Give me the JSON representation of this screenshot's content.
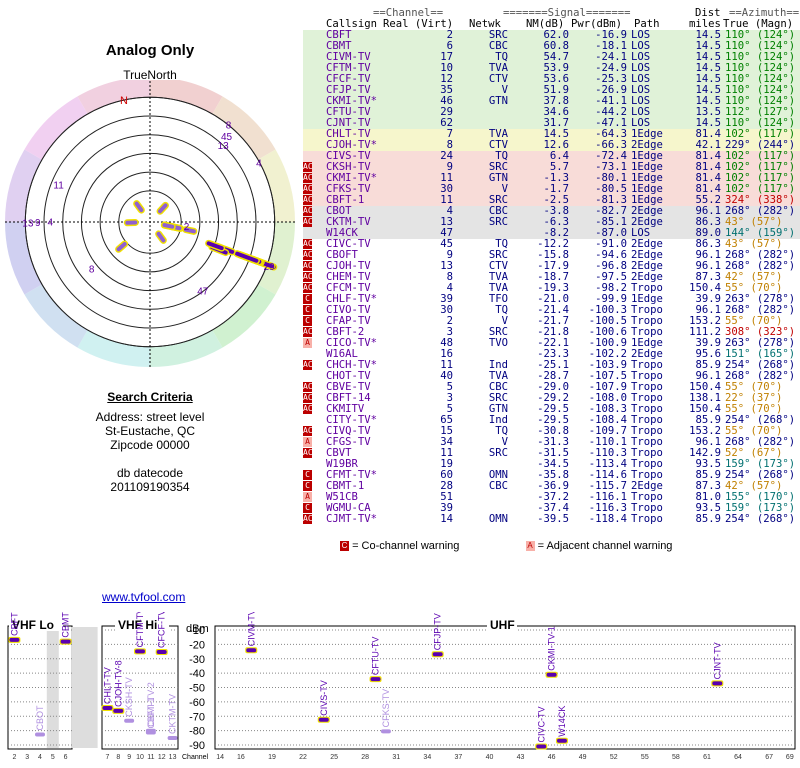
{
  "title": "Analog Only",
  "true_north": "TrueNorth",
  "compass_n": "N",
  "search": {
    "heading": "Search Criteria",
    "address": "Address: street level",
    "city": "St-Eustache, QC",
    "zip": "Zipcode 00000",
    "db_label": "db datecode",
    "db_value": "201109190354"
  },
  "link": "www.tvfool.com",
  "table_headers": {
    "channel_group": "==Channel==",
    "signal_group": "=======Signal=======",
    "dist_group": "Dist",
    "azimuth_group": "==Azimuth==",
    "callsign": "Callsign",
    "real_virt": "Real (Virt)",
    "netwk": "Netwk",
    "nm": "NM(dB)",
    "pwr": "Pwr(dBm)",
    "path": "Path",
    "miles": "miles",
    "az": "True (Magn)"
  },
  "colors": {
    "green": "#e0f2d8",
    "yellow": "#f6f6cc",
    "red": "#f8dcd8",
    "grey": "#e4e4e4",
    "white": "#ffffff",
    "purple": "#7000b0",
    "green_az": "#008000",
    "red_az": "#c00000",
    "orange_az": "#c08000",
    "blue_az": "#000080",
    "teal_az": "#007070"
  },
  "stations": [
    {
      "call": "CBFT",
      "real": "2",
      "virt": "",
      "net": "SRC",
      "nm": "62.0",
      "pwr": "-16.9",
      "path": "LOS",
      "dist": "14.5",
      "az": "110° (124°)",
      "bg": "green",
      "warn": "",
      "azc": "green_az"
    },
    {
      "call": "CBMT",
      "real": "6",
      "virt": "",
      "net": "CBC",
      "nm": "60.8",
      "pwr": "-18.1",
      "path": "LOS",
      "dist": "14.5",
      "az": "110° (124°)",
      "bg": "green",
      "warn": "",
      "azc": "green_az"
    },
    {
      "call": "CIVM-TV",
      "real": "17",
      "virt": "",
      "net": "TQ",
      "nm": "54.7",
      "pwr": "-24.1",
      "path": "LOS",
      "dist": "14.5",
      "az": "110° (124°)",
      "bg": "green",
      "warn": "",
      "azc": "green_az"
    },
    {
      "call": "CFTM-TV",
      "real": "10",
      "virt": "",
      "net": "TVA",
      "nm": "53.9",
      "pwr": "-24.9",
      "path": "LOS",
      "dist": "14.5",
      "az": "110° (124°)",
      "bg": "green",
      "warn": "",
      "azc": "green_az"
    },
    {
      "call": "CFCF-TV",
      "real": "12",
      "virt": "",
      "net": "CTV",
      "nm": "53.6",
      "pwr": "-25.3",
      "path": "LOS",
      "dist": "14.5",
      "az": "110° (124°)",
      "bg": "green",
      "warn": "",
      "azc": "green_az"
    },
    {
      "call": "CFJP-TV",
      "real": "35",
      "virt": "",
      "net": "V",
      "nm": "51.9",
      "pwr": "-26.9",
      "path": "LOS",
      "dist": "14.5",
      "az": "110° (124°)",
      "bg": "green",
      "warn": "",
      "azc": "green_az"
    },
    {
      "call": "CKMI-TV*",
      "real": "46",
      "virt": "",
      "net": "GTN",
      "nm": "37.8",
      "pwr": "-41.1",
      "path": "LOS",
      "dist": "14.5",
      "az": "110° (124°)",
      "bg": "green",
      "warn": "",
      "azc": "green_az"
    },
    {
      "call": "CFTU-TV",
      "real": "29",
      "virt": "",
      "net": "",
      "nm": "34.6",
      "pwr": "-44.2",
      "path": "LOS",
      "dist": "13.5",
      "az": "112° (127°)",
      "bg": "green",
      "warn": "",
      "azc": "green_az"
    },
    {
      "call": "CJNT-TV",
      "real": "62",
      "virt": "",
      "net": "",
      "nm": "31.7",
      "pwr": "-47.1",
      "path": "LOS",
      "dist": "14.5",
      "az": "110° (124°)",
      "bg": "green",
      "warn": "",
      "azc": "green_az"
    },
    {
      "call": "CHLT-TV",
      "real": "7",
      "virt": "",
      "net": "TVA",
      "nm": "14.5",
      "pwr": "-64.3",
      "path": "1Edge",
      "dist": "81.4",
      "az": "102° (117°)",
      "bg": "yellow",
      "warn": "",
      "azc": "green_az"
    },
    {
      "call": "CJOH-TV*",
      "real": "8",
      "virt": "",
      "net": "CTV",
      "nm": "12.6",
      "pwr": "-66.3",
      "path": "2Edge",
      "dist": "42.1",
      "az": "229° (244°)",
      "bg": "yellow",
      "warn": "",
      "azc": "blue_az"
    },
    {
      "call": "CIVS-TV",
      "real": "24",
      "virt": "",
      "net": "TQ",
      "nm": "6.4",
      "pwr": "-72.4",
      "path": "1Edge",
      "dist": "81.4",
      "az": "102° (117°)",
      "bg": "red",
      "warn": "",
      "azc": "green_az"
    },
    {
      "call": "CKSH-TV",
      "real": "9",
      "virt": "",
      "net": "SRC",
      "nm": "5.7",
      "pwr": "-73.1",
      "path": "1Edge",
      "dist": "81.4",
      "az": "102° (117°)",
      "bg": "red",
      "warn": "AC",
      "azc": "green_az"
    },
    {
      "call": "CKMI-TV*",
      "real": "11",
      "virt": "",
      "net": "GTN",
      "nm": "-1.3",
      "pwr": "-80.1",
      "path": "1Edge",
      "dist": "81.4",
      "az": "102° (117°)",
      "bg": "red",
      "warn": "AC",
      "azc": "green_az"
    },
    {
      "call": "CFKS-TV",
      "real": "30",
      "virt": "",
      "net": "V",
      "nm": "-1.7",
      "pwr": "-80.5",
      "path": "1Edge",
      "dist": "81.4",
      "az": "102° (117°)",
      "bg": "red",
      "warn": "AC",
      "azc": "green_az"
    },
    {
      "call": "CBFT-1",
      "real": "11",
      "virt": "",
      "net": "SRC",
      "nm": "-2.5",
      "pwr": "-81.3",
      "path": "1Edge",
      "dist": "55.2",
      "az": "324° (338°)",
      "bg": "red",
      "warn": "AC",
      "azc": "red_az"
    },
    {
      "call": "CBOT",
      "real": "4",
      "virt": "",
      "net": "CBC",
      "nm": "-3.8",
      "pwr": "-82.7",
      "path": "2Edge",
      "dist": "96.1",
      "az": "268° (282°)",
      "bg": "grey",
      "warn": "AC",
      "azc": "blue_az"
    },
    {
      "call": "CKTM-TV",
      "real": "13",
      "virt": "",
      "net": "SRC",
      "nm": "-6.3",
      "pwr": "-85.1",
      "path": "2Edge",
      "dist": "86.3",
      "az": "43° (57°)",
      "bg": "grey",
      "warn": "AC",
      "azc": "orange_az"
    },
    {
      "call": "W14CK",
      "real": "47",
      "virt": "",
      "net": "",
      "nm": "-8.2",
      "pwr": "-87.0",
      "path": "LOS",
      "dist": "89.0",
      "az": "144° (159°)",
      "bg": "grey",
      "warn": "",
      "azc": "teal_az"
    },
    {
      "call": "CIVC-TV",
      "real": "45",
      "virt": "",
      "net": "TQ",
      "nm": "-12.2",
      "pwr": "-91.0",
      "path": "2Edge",
      "dist": "86.3",
      "az": "43° (57°)",
      "bg": "white",
      "warn": "AC",
      "azc": "orange_az"
    },
    {
      "call": "CBOFT",
      "real": "9",
      "virt": "",
      "net": "SRC",
      "nm": "-15.8",
      "pwr": "-94.6",
      "path": "2Edge",
      "dist": "96.1",
      "az": "268° (282°)",
      "bg": "white",
      "warn": "AC",
      "azc": "blue_az"
    },
    {
      "call": "CJOH-TV",
      "real": "13",
      "virt": "",
      "net": "CTV",
      "nm": "-17.9",
      "pwr": "-96.8",
      "path": "2Edge",
      "dist": "96.1",
      "az": "268° (282°)",
      "bg": "white",
      "warn": "AC",
      "azc": "blue_az"
    },
    {
      "call": "CHEM-TV",
      "real": "8",
      "virt": "",
      "net": "TVA",
      "nm": "-18.7",
      "pwr": "-97.5",
      "path": "2Edge",
      "dist": "87.3",
      "az": "42° (57°)",
      "bg": "white",
      "warn": "AC",
      "azc": "orange_az"
    },
    {
      "call": "CFCM-TV",
      "real": "4",
      "virt": "",
      "net": "TVA",
      "nm": "-19.3",
      "pwr": "-98.2",
      "path": "Tropo",
      "dist": "150.4",
      "az": "55° (70°)",
      "bg": "white",
      "warn": "AC",
      "azc": "orange_az"
    },
    {
      "call": "CHLF-TV*",
      "real": "39",
      "virt": "",
      "net": "TFO",
      "nm": "-21.0",
      "pwr": "-99.9",
      "path": "1Edge",
      "dist": "39.9",
      "az": "263° (278°)",
      "bg": "white",
      "warn": "C",
      "azc": "blue_az"
    },
    {
      "call": "CIVO-TV",
      "real": "30",
      "virt": "",
      "net": "TQ",
      "nm": "-21.4",
      "pwr": "-100.3",
      "path": "Tropo",
      "dist": "96.1",
      "az": "268° (282°)",
      "bg": "white",
      "warn": "C",
      "azc": "blue_az"
    },
    {
      "call": "CFAP-TV",
      "real": "2",
      "virt": "",
      "net": "V",
      "nm": "-21.7",
      "pwr": "-100.5",
      "path": "Tropo",
      "dist": "153.2",
      "az": "55° (70°)",
      "bg": "white",
      "warn": "C",
      "azc": "orange_az"
    },
    {
      "call": "CBFT-2",
      "real": "3",
      "virt": "",
      "net": "SRC",
      "nm": "-21.8",
      "pwr": "-100.6",
      "path": "Tropo",
      "dist": "111.2",
      "az": "308° (323°)",
      "bg": "white",
      "warn": "AC",
      "azc": "red_az"
    },
    {
      "call": "CICO-TV*",
      "real": "48",
      "virt": "",
      "net": "TVO",
      "nm": "-22.1",
      "pwr": "-100.9",
      "path": "1Edge",
      "dist": "39.9",
      "az": "263° (278°)",
      "bg": "white",
      "warn": "A",
      "azc": "blue_az"
    },
    {
      "call": "W16AL",
      "real": "16",
      "virt": "",
      "net": "",
      "nm": "-23.3",
      "pwr": "-102.2",
      "path": "2Edge",
      "dist": "95.6",
      "az": "151° (165°)",
      "bg": "white",
      "warn": "",
      "azc": "teal_az"
    },
    {
      "call": "CHCH-TV*",
      "real": "11",
      "virt": "",
      "net": "Ind",
      "nm": "-25.1",
      "pwr": "-103.9",
      "path": "Tropo",
      "dist": "85.9",
      "az": "254° (268°)",
      "bg": "white",
      "warn": "AC",
      "azc": "blue_az"
    },
    {
      "call": "CHOT-TV",
      "real": "40",
      "virt": "",
      "net": "TVA",
      "nm": "-28.7",
      "pwr": "-107.5",
      "path": "Tropo",
      "dist": "96.1",
      "az": "268° (282°)",
      "bg": "white",
      "warn": "",
      "azc": "blue_az"
    },
    {
      "call": "CBVE-TV",
      "real": "5",
      "virt": "",
      "net": "CBC",
      "nm": "-29.0",
      "pwr": "-107.9",
      "path": "Tropo",
      "dist": "150.4",
      "az": "55° (70°)",
      "bg": "white",
      "warn": "AC",
      "azc": "orange_az"
    },
    {
      "call": "CBFT-14",
      "real": "3",
      "virt": "",
      "net": "SRC",
      "nm": "-29.2",
      "pwr": "-108.0",
      "path": "Tropo",
      "dist": "138.1",
      "az": "22° (37°)",
      "bg": "white",
      "warn": "AC",
      "azc": "orange_az"
    },
    {
      "call": "CKMITV",
      "real": "5",
      "virt": "",
      "net": "GTN",
      "nm": "-29.5",
      "pwr": "-108.3",
      "path": "Tropo",
      "dist": "150.4",
      "az": "55° (70°)",
      "bg": "white",
      "warn": "AC",
      "azc": "orange_az"
    },
    {
      "call": "CITY-TV*",
      "real": "65",
      "virt": "",
      "net": "Ind",
      "nm": "-29.5",
      "pwr": "-108.4",
      "path": "Tropo",
      "dist": "85.9",
      "az": "254° (268°)",
      "bg": "white",
      "warn": "",
      "azc": "blue_az"
    },
    {
      "call": "CIVQ-TV",
      "real": "15",
      "virt": "",
      "net": "TQ",
      "nm": "-30.8",
      "pwr": "-109.7",
      "path": "Tropo",
      "dist": "153.2",
      "az": "55° (70°)",
      "bg": "white",
      "warn": "AC",
      "azc": "orange_az"
    },
    {
      "call": "CFGS-TV",
      "real": "34",
      "virt": "",
      "net": "V",
      "nm": "-31.3",
      "pwr": "-110.1",
      "path": "Tropo",
      "dist": "96.1",
      "az": "268° (282°)",
      "bg": "white",
      "warn": "A",
      "azc": "blue_az"
    },
    {
      "call": "CBVT",
      "real": "11",
      "virt": "",
      "net": "SRC",
      "nm": "-31.5",
      "pwr": "-110.3",
      "path": "Tropo",
      "dist": "142.9",
      "az": "52° (67°)",
      "bg": "white",
      "warn": "AC",
      "azc": "orange_az"
    },
    {
      "call": "W19BR",
      "real": "19",
      "virt": "",
      "net": "",
      "nm": "-34.5",
      "pwr": "-113.4",
      "path": "Tropo",
      "dist": "93.5",
      "az": "159° (173°)",
      "bg": "white",
      "warn": "",
      "azc": "teal_az"
    },
    {
      "call": "CFMT-TV*",
      "real": "60",
      "virt": "",
      "net": "OMN",
      "nm": "-35.8",
      "pwr": "-114.6",
      "path": "Tropo",
      "dist": "85.9",
      "az": "254° (268°)",
      "bg": "white",
      "warn": "C",
      "azc": "blue_az"
    },
    {
      "call": "CBMT-1",
      "real": "28",
      "virt": "",
      "net": "CBC",
      "nm": "-36.9",
      "pwr": "-115.7",
      "path": "2Edge",
      "dist": "87.3",
      "az": "42° (57°)",
      "bg": "white",
      "warn": "C",
      "azc": "orange_az"
    },
    {
      "call": "W51CB",
      "real": "51",
      "virt": "",
      "net": "",
      "nm": "-37.2",
      "pwr": "-116.1",
      "path": "Tropo",
      "dist": "81.0",
      "az": "155° (170°)",
      "bg": "white",
      "warn": "A",
      "azc": "teal_az"
    },
    {
      "call": "WGMU-CA",
      "real": "39",
      "virt": "",
      "net": "",
      "nm": "-37.4",
      "pwr": "-116.3",
      "path": "Tropo",
      "dist": "93.5",
      "az": "159° (173°)",
      "bg": "white",
      "warn": "C",
      "azc": "teal_az"
    },
    {
      "call": "CJMT-TV*",
      "real": "14",
      "virt": "",
      "net": "OMN",
      "nm": "-39.5",
      "pwr": "-118.4",
      "path": "Tropo",
      "dist": "85.9",
      "az": "254° (268°)",
      "bg": "white",
      "warn": "AC",
      "azc": "blue_az"
    }
  ],
  "legend": {
    "co_icon": "C",
    "co_text": "= Co-channel warning",
    "adj_icon": "A",
    "adj_text": "= Adjacent channel warning"
  },
  "polar_labels": [
    {
      "text": "11",
      "az": 290,
      "r": 0.78
    },
    {
      "text": "8",
      "az": 40,
      "r": 0.98
    },
    {
      "text": "45",
      "az": 43,
      "r": 0.9
    },
    {
      "text": "13",
      "az": 45,
      "r": 0.83
    },
    {
      "text": "4",
      "az": 63,
      "r": 0.98
    },
    {
      "text": "13",
      "az": 268,
      "r": 0.98
    },
    {
      "text": "9",
      "az": 268,
      "r": 0.9
    },
    {
      "text": "4",
      "az": 268,
      "r": 0.8
    },
    {
      "text": "8",
      "az": 229,
      "r": 0.62
    },
    {
      "text": "47",
      "az": 144,
      "r": 0.72
    },
    {
      "text": "2",
      "az": 102,
      "r": 0.3
    },
    {
      "text": "29",
      "az": 112,
      "r": 1.03
    }
  ],
  "chart_data": {
    "type": "scatter",
    "title": "",
    "ylabel": "dBm",
    "ylim": [
      -90,
      -10
    ],
    "yticks": [
      -10,
      -20,
      -30,
      -40,
      -50,
      -60,
      -70,
      -80,
      -90
    ],
    "sections": [
      "VHF Lo",
      "VHF Hi",
      "UHF"
    ],
    "x_channels_lo": [
      "2",
      "3",
      "4",
      "5",
      "6"
    ],
    "x_channels_hi": [
      "7",
      "8",
      "9",
      "10",
      "11",
      "12",
      "13"
    ],
    "x_channels_uhf": [
      "14",
      "16",
      "19",
      "22",
      "25",
      "28",
      "31",
      "34",
      "37",
      "40",
      "43",
      "46",
      "49",
      "52",
      "55",
      "58",
      "61",
      "64",
      "67",
      "69"
    ],
    "x_label": "Channel",
    "points": [
      {
        "call": "CBFT",
        "ch": 2,
        "pwr": -16.9,
        "strong": true
      },
      {
        "call": "CBMT",
        "ch": 6,
        "pwr": -18.1,
        "strong": true
      },
      {
        "call": "CBOT",
        "ch": 4,
        "pwr": -82.7,
        "strong": false
      },
      {
        "call": "CHLT-TV",
        "ch": 7,
        "pwr": -64.3,
        "strong": true
      },
      {
        "call": "CJOH-TV-8",
        "ch": 8,
        "pwr": -66.3,
        "strong": true
      },
      {
        "call": "CKSH-TV",
        "ch": 9,
        "pwr": -73.1,
        "strong": false
      },
      {
        "call": "CFTM-TV",
        "ch": 10,
        "pwr": -24.9,
        "strong": true
      },
      {
        "call": "CBFT-1",
        "ch": 11,
        "pwr": -81.3,
        "strong": false
      },
      {
        "call": "CKMI-TV-2",
        "ch": 11,
        "pwr": -80.1,
        "strong": false
      },
      {
        "call": "CFCF-TV",
        "ch": 12,
        "pwr": -25.3,
        "strong": true
      },
      {
        "call": "CKTM-TV",
        "ch": 13,
        "pwr": -85.1,
        "strong": false
      },
      {
        "call": "CIVM-TV",
        "ch": 17,
        "pwr": -24.1,
        "strong": true
      },
      {
        "call": "CIVS-TV",
        "ch": 24,
        "pwr": -72.4,
        "strong": true
      },
      {
        "call": "CFTU-TV",
        "ch": 29,
        "pwr": -44.2,
        "strong": true
      },
      {
        "call": "CFKS-TV",
        "ch": 30,
        "pwr": -80.5,
        "strong": false
      },
      {
        "call": "CFJP-TV",
        "ch": 35,
        "pwr": -26.9,
        "strong": true
      },
      {
        "call": "CIVC-TV",
        "ch": 45,
        "pwr": -91.0,
        "strong": true
      },
      {
        "call": "CKMI-TV-1",
        "ch": 46,
        "pwr": -41.1,
        "strong": true
      },
      {
        "call": "W14CK",
        "ch": 47,
        "pwr": -87.0,
        "strong": true
      },
      {
        "call": "CJNT-TV",
        "ch": 62,
        "pwr": -47.1,
        "strong": true
      }
    ]
  }
}
